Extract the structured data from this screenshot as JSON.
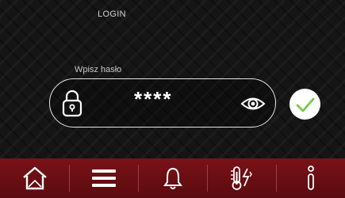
{
  "header": {
    "title": "LOGIN"
  },
  "password": {
    "label": "Wpisz hasło",
    "masked_value": "****",
    "lock_icon": "lock-icon",
    "toggle_icon": "eye-icon"
  },
  "confirm": {
    "icon": "checkmark-icon",
    "accent": "#7cc84a"
  },
  "nav": {
    "background": "#6b0f14",
    "items": [
      {
        "icon": "home-icon"
      },
      {
        "icon": "menu-icon"
      },
      {
        "icon": "bell-icon"
      },
      {
        "icon": "thermometer-icon"
      },
      {
        "icon": "info-icon"
      }
    ]
  }
}
